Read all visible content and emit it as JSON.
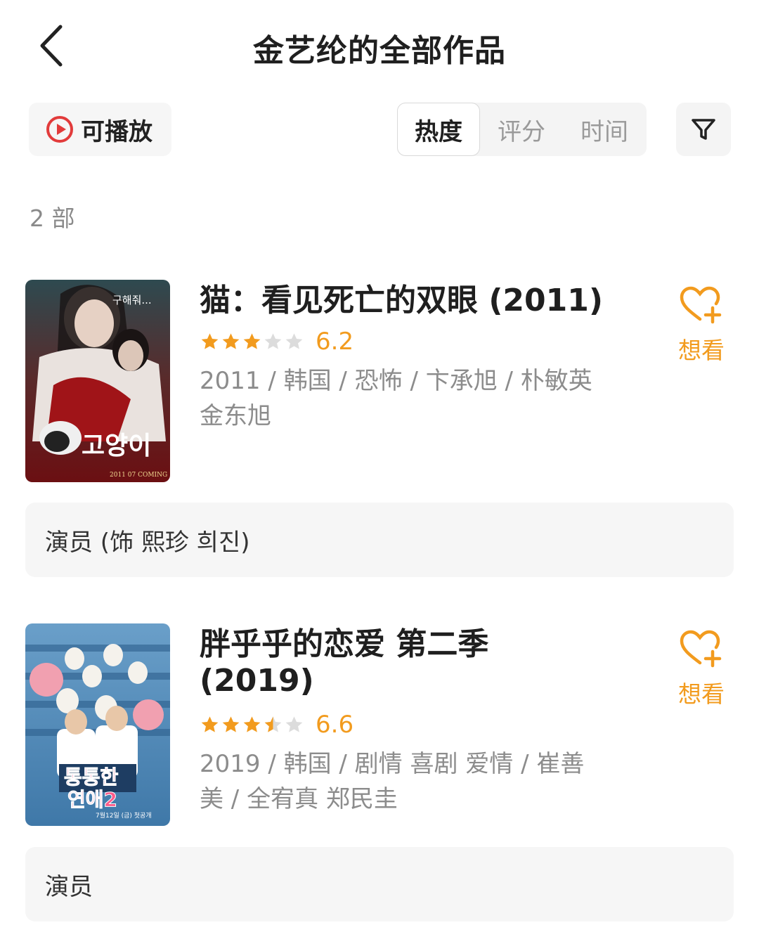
{
  "header": {
    "title": "金艺纶的全部作品"
  },
  "toolbar": {
    "playable_label": "可播放",
    "sort_tabs": [
      "热度",
      "评分",
      "时间"
    ],
    "active_sort": "热度"
  },
  "count_label": "2 部",
  "colors": {
    "accent": "#f29b1e",
    "play_red": "#e23b3b",
    "muted_text": "#8c8c8c"
  },
  "movies": [
    {
      "title": "猫：看见死亡的双眼 (2011)",
      "rating": 6.2,
      "rating_label": "6.2",
      "stars_out_of_5": 3,
      "meta": "2011 / 韩国 / 恐怖 / 卞承旭 / 朴敏英 金东旭",
      "want_label": "想看",
      "role": "演员 (饰 熙珍 희진)",
      "poster_text": "고양이",
      "poster_tagline": "구해줘...",
      "poster_date": "2011 07 COMING"
    },
    {
      "title": "胖乎乎的恋爱 第二季 (2019)",
      "rating": 6.6,
      "rating_label": "6.6",
      "stars_out_of_5": 3.5,
      "meta": "2019 / 韩国 / 剧情 喜剧 爱情 / 崔善美 / 全宥真 郑民圭",
      "want_label": "想看",
      "role": "演员",
      "poster_text_line1": "통통한",
      "poster_text_line2": "연애2",
      "poster_date": "7월12일 (금) 첫공개"
    }
  ]
}
